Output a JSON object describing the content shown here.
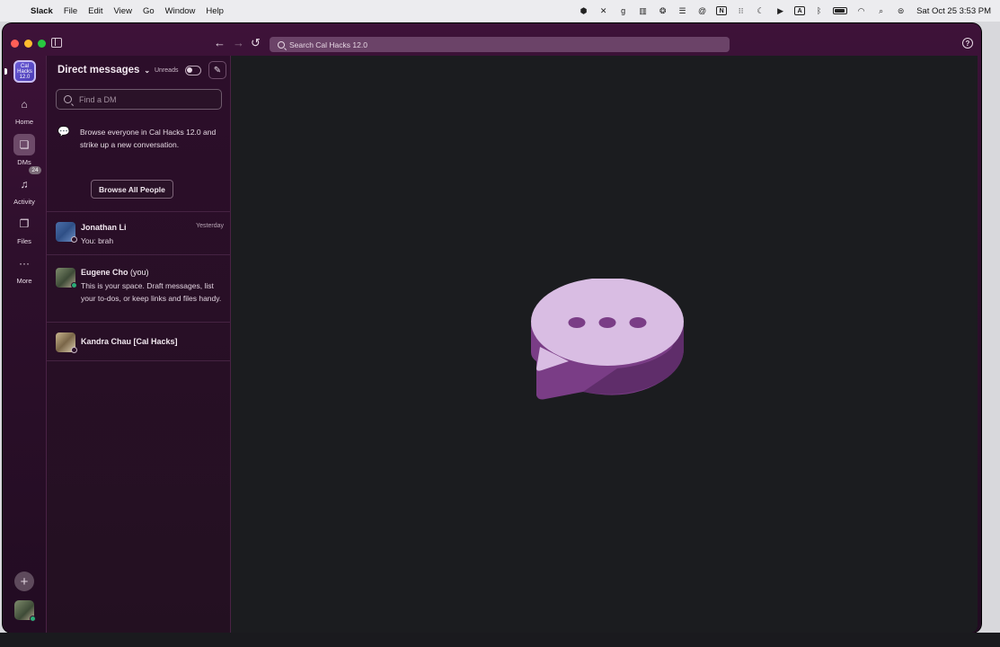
{
  "menubar": {
    "app": "Slack",
    "items": [
      "File",
      "Edit",
      "View",
      "Go",
      "Window",
      "Help"
    ],
    "tray": {
      "box_letter_g": "g",
      "box_letter_n": "N",
      "box_letter_a": "A"
    },
    "clock": "Sat Oct 25  3:53 PM"
  },
  "toolbar": {
    "search_placeholder": "Search Cal Hacks 12.0"
  },
  "rail": {
    "workspace_label": "Cal Hacks 12.0",
    "items": [
      {
        "label": "Home",
        "icon": "home-icon"
      },
      {
        "label": "DMs",
        "icon": "dms-icon"
      },
      {
        "label": "Activity",
        "icon": "bell-icon",
        "badge": "24"
      },
      {
        "label": "Files",
        "icon": "files-icon"
      },
      {
        "label": "More",
        "icon": "more-icon"
      }
    ]
  },
  "dm_panel": {
    "title": "Direct messages",
    "unreads_label": "Unreads",
    "find_placeholder": "Find a DM",
    "browse_text": "Browse everyone in Cal Hacks 12.0 and strike up a new conversation.",
    "browse_button": "Browse All People",
    "conversations": [
      {
        "name": "Jonathan Li",
        "time": "Yesterday",
        "preview": "You: brah"
      },
      {
        "name": "Eugene Cho",
        "suffix": "(you)",
        "preview": "This is your space. Draft messages, list your to-dos, or keep links and files handy."
      },
      {
        "name": "Kandra Chau [Cal Hacks]"
      }
    ]
  },
  "colors": {
    "window_bg": "#3b1436",
    "main_bg": "#1b1c1f",
    "bubble_top": "#d9bde3",
    "bubble_side": "#7a3d86",
    "online": "#2bac76"
  }
}
